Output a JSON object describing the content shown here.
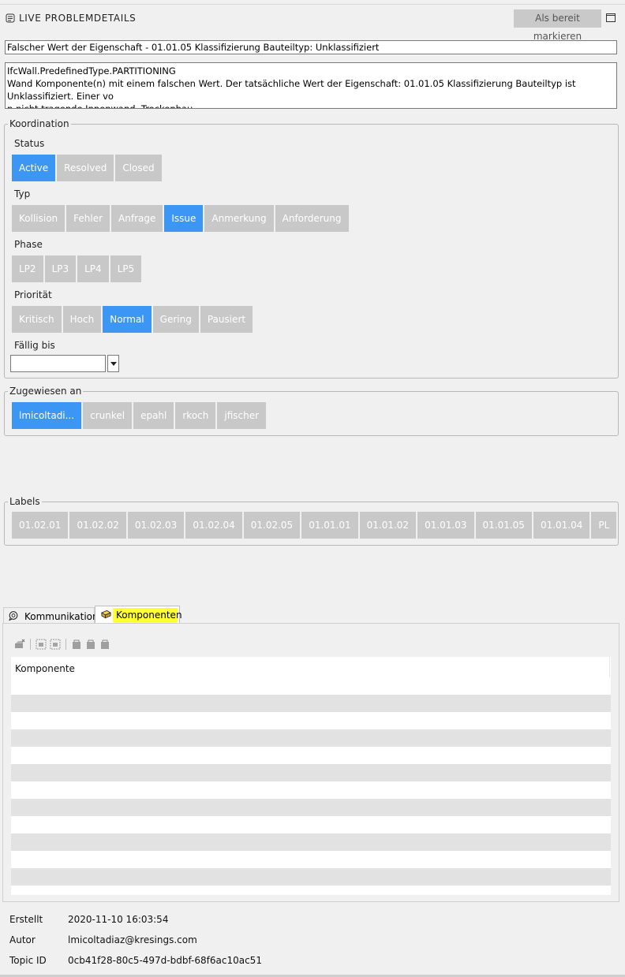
{
  "header": {
    "title": "LIVE PROBLEMDETAILS",
    "ready_button": "Als bereit markieren"
  },
  "issue": {
    "title": "Falscher Wert der Eigenschaft - 01.01.05 Klassifizierung Bauteiltyp: Unklassifiziert",
    "description_line1": "IfcWall.PredefinedType.PARTITIONING",
    "description_line2": "Wand Komponente(n) mit einem falschen Wert. Der tatsächliche Wert der Eigenschaft: 01.01.05 Klassifizierung Bauteiltyp ist Unklassifiziert. Einer vo",
    "description_line3": "n nicht tragende Innenwand, Trockenbau."
  },
  "koordination": {
    "legend": "Koordination",
    "status": {
      "label": "Status",
      "options": [
        "Active",
        "Resolved",
        "Closed"
      ],
      "selected": "Active"
    },
    "typ": {
      "label": "Typ",
      "options": [
        "Kollision",
        "Fehler",
        "Anfrage",
        "Issue",
        "Anmerkung",
        "Anforderung"
      ],
      "selected": "Issue"
    },
    "phase": {
      "label": "Phase",
      "options": [
        "LP2",
        "LP3",
        "LP4",
        "LP5"
      ],
      "selected": ""
    },
    "prioritaet": {
      "label": "Priorität",
      "options": [
        "Kritisch",
        "Hoch",
        "Normal",
        "Gering",
        "Pausiert"
      ],
      "selected": "Normal"
    },
    "faellig": {
      "label": "Fällig bis",
      "value": ""
    }
  },
  "zugewiesen": {
    "legend": "Zugewiesen an",
    "options": [
      "lmicoltadi...",
      "crunkel",
      "epahl",
      "rkoch",
      "jfischer"
    ],
    "selected": "lmicoltadi..."
  },
  "labels": {
    "legend": "Labels",
    "options": [
      "01.02.01",
      "01.02.02",
      "01.02.03",
      "01.02.04",
      "01.02.05",
      "01.01.01",
      "01.01.02",
      "01.01.03",
      "01.01.05",
      "01.01.04",
      "PL"
    ]
  },
  "tabs": {
    "kommunikation": "Kommunikation",
    "komponenten": "Komponenten"
  },
  "components_table": {
    "column": "Komponente",
    "row_count": 12
  },
  "meta": {
    "erstellt_label": "Erstellt",
    "erstellt_value": "2020-11-10 16:03:54",
    "autor_label": "Autor",
    "autor_value": "lmicoltadiaz@kresings.com",
    "topic_label": "Topic ID",
    "topic_value": "0cb41f28-80c5-497d-bdbf-68f6ac10ac51"
  },
  "colors": {
    "active_chip": "#3c97f4",
    "inactive_chip": "#c8c8c8",
    "tab_highlight": "#ffff33"
  }
}
